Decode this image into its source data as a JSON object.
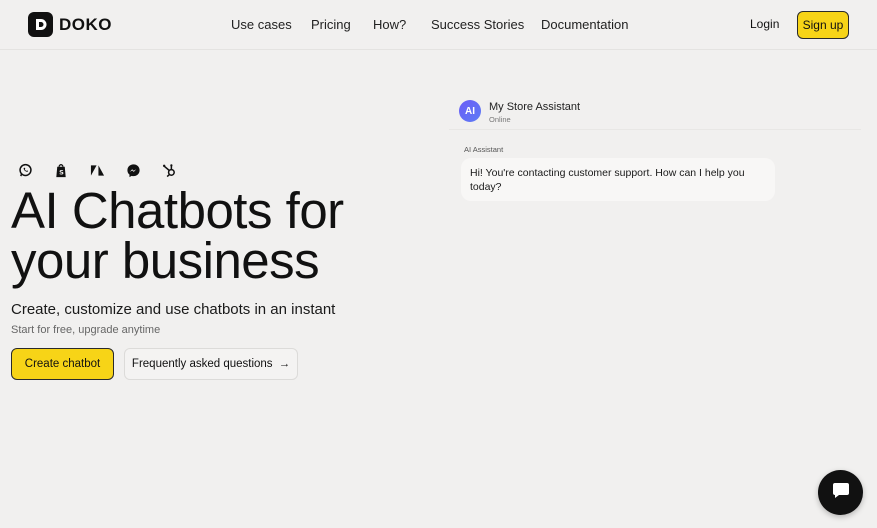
{
  "brand": {
    "name": "DOKO",
    "logo_letter": "D"
  },
  "nav": {
    "items": [
      "Use cases",
      "Pricing",
      "How?",
      "Success Stories",
      "Documentation"
    ],
    "login": "Login",
    "signup": "Sign up"
  },
  "hero": {
    "integration_icons": [
      "whatsapp-icon",
      "shopify-icon",
      "zendesk-icon",
      "messenger-icon",
      "hubspot-icon"
    ],
    "title_line1": "AI Chatbots for",
    "title_line2": "your business",
    "subtitle": "Create, customize and use chatbots in an instant",
    "note": "Start for free, upgrade anytime",
    "cta_primary": "Create chatbot",
    "cta_secondary": "Frequently asked questions",
    "cta_secondary_arrow": "→"
  },
  "chat_preview": {
    "avatar_initials": "AI",
    "bot_name": "My Store Assistant",
    "status": "Online",
    "message_sender": "AI Assistant",
    "message": "Hi! You're contacting customer support. How can I help you today?"
  },
  "launcher": {
    "icon": "chat-bubble-icon"
  },
  "colors": {
    "accent": "#f7d417",
    "background": "#f1f0ef",
    "text": "#111111",
    "avatar": "#6b5cf6"
  }
}
